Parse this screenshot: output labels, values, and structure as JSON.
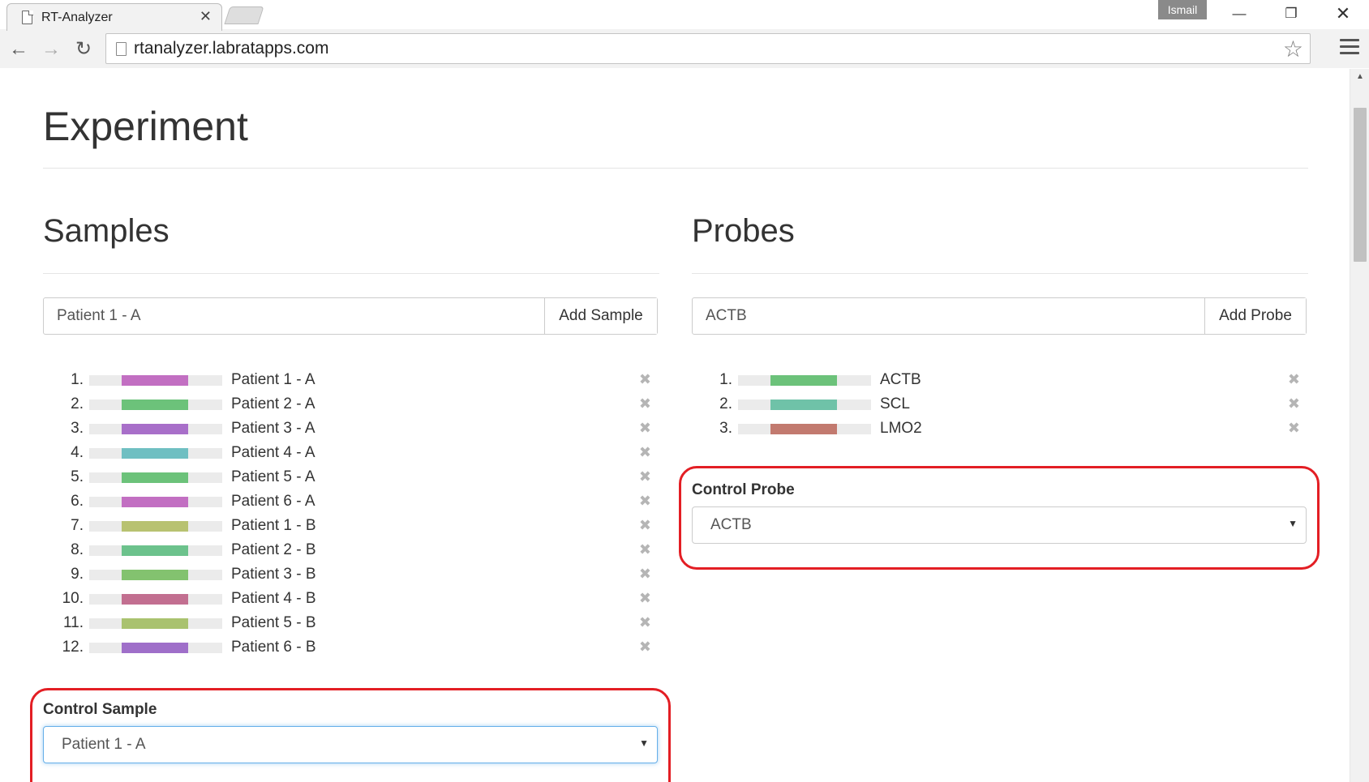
{
  "browser": {
    "tab_title": "RT-Analyzer",
    "tab_close": "✕",
    "url": "rtanalyzer.labratapps.com",
    "user": "Ismail",
    "minimize": "—",
    "restore": "❐",
    "close": "✕",
    "back": "←",
    "forward": "→",
    "reload": "↻",
    "star": "☆"
  },
  "page": {
    "title": "Experiment"
  },
  "samples": {
    "heading": "Samples",
    "input_value": "Patient 1 - A",
    "add_label": "Add Sample",
    "items": [
      {
        "num": "1.",
        "label": "Patient 1 - A",
        "color": "#c26fc2"
      },
      {
        "num": "2.",
        "label": "Patient 2 - A",
        "color": "#6cc27a"
      },
      {
        "num": "3.",
        "label": "Patient 3 - A",
        "color": "#a86fc9"
      },
      {
        "num": "4.",
        "label": "Patient 4 - A",
        "color": "#6fbfc2"
      },
      {
        "num": "5.",
        "label": "Patient 5 - A",
        "color": "#6cc27a"
      },
      {
        "num": "6.",
        "label": "Patient 6 - A",
        "color": "#c26fc2"
      },
      {
        "num": "7.",
        "label": "Patient 1 - B",
        "color": "#b8c271"
      },
      {
        "num": "8.",
        "label": "Patient 2 - B",
        "color": "#6cc28c"
      },
      {
        "num": "9.",
        "label": "Patient 3 - B",
        "color": "#83c26f"
      },
      {
        "num": "10.",
        "label": "Patient 4 - B",
        "color": "#c26f90"
      },
      {
        "num": "11.",
        "label": "Patient 5 - B",
        "color": "#a9c26f"
      },
      {
        "num": "12.",
        "label": "Patient 6 - B",
        "color": "#9f6fc9"
      }
    ],
    "remove_glyph": "✖",
    "control_label": "Control Sample",
    "control_value": "Patient 1 - A"
  },
  "probes": {
    "heading": "Probes",
    "input_value": "ACTB",
    "add_label": "Add Probe",
    "items": [
      {
        "num": "1.",
        "label": "ACTB",
        "color": "#6cc27a"
      },
      {
        "num": "2.",
        "label": "SCL",
        "color": "#6fc2a8"
      },
      {
        "num": "3.",
        "label": "LMO2",
        "color": "#c27a6f"
      }
    ],
    "remove_glyph": "✖",
    "control_label": "Control Probe",
    "control_value": "ACTB"
  },
  "select_caret": "▼"
}
